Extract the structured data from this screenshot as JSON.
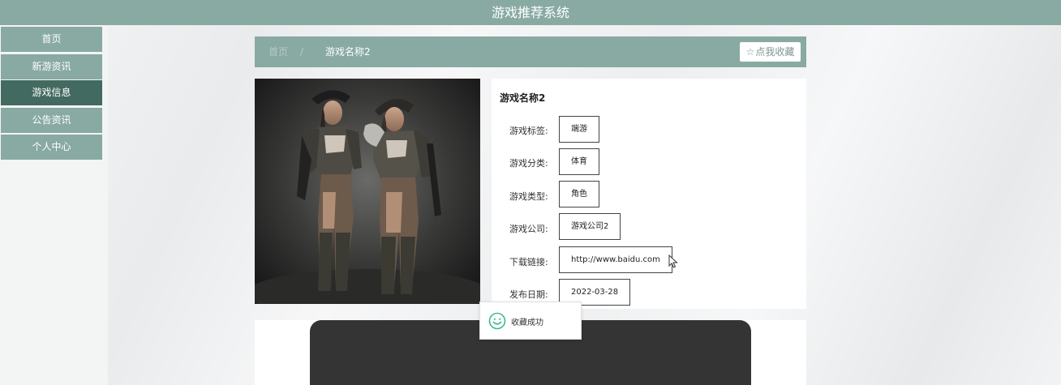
{
  "app_title": "游戏推荐系统",
  "sidebar": {
    "items": [
      {
        "label": "首页"
      },
      {
        "label": "新游资讯"
      },
      {
        "label": "游戏信息"
      },
      {
        "label": "公告资讯"
      },
      {
        "label": "个人中心"
      }
    ],
    "active_item": "游戏信息"
  },
  "breadcrumb": {
    "home": "首页",
    "separator": "/",
    "current": "游戏名称2"
  },
  "favorite_button": {
    "icon": "star-outline-icon",
    "label": "点我收藏"
  },
  "game": {
    "name": "游戏名称2",
    "fields": [
      {
        "label": "游戏标签:",
        "value": "端游"
      },
      {
        "label": "游戏分类:",
        "value": "体育"
      },
      {
        "label": "游戏类型:",
        "value": "角色"
      },
      {
        "label": "游戏公司:",
        "value": "游戏公司2"
      },
      {
        "label": "下载链接:",
        "value": "http://www.baidu.com"
      },
      {
        "label": "发布日期:",
        "value": "2022-03-28"
      }
    ]
  },
  "toast": {
    "icon": "smile-icon",
    "message": "收藏成功"
  },
  "colors": {
    "header_bg": "#88aaa2",
    "sidebar_active_bg": "#436a60",
    "toast_icon": "#3dbb8a"
  }
}
